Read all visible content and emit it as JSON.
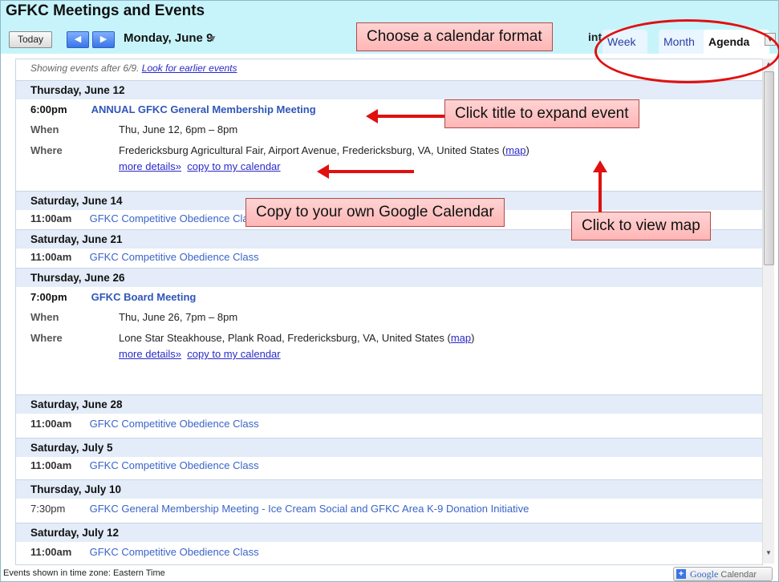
{
  "header": {
    "title": "GFKC Meetings and Events",
    "today_label": "Today",
    "prev_icon": "◀",
    "next_icon": "▶",
    "date": "Monday, June 9",
    "print_partial": "int",
    "tabs": [
      "Week",
      "Month",
      "Agenda"
    ]
  },
  "notice": {
    "text": "Showing events after 6/9.",
    "link": "Look for earlier events"
  },
  "days": [
    {
      "label": "Thursday, June 12"
    },
    {
      "label": "Saturday, June 14"
    },
    {
      "label": "Saturday, June 21"
    },
    {
      "label": "Thursday, June 26"
    },
    {
      "label": "Saturday, June 28"
    },
    {
      "label": "Saturday, July 5"
    },
    {
      "label": "Thursday, July 10"
    },
    {
      "label": "Saturday, July 12"
    }
  ],
  "events": [
    {
      "time": "6:00pm",
      "title": "ANNUAL GFKC General Membership Meeting"
    },
    {
      "time": "11:00am",
      "title": "GFKC Competitive Obedience Class"
    },
    {
      "time": "11:00am",
      "title": "GFKC Competitive Obedience Class"
    },
    {
      "time": "7:00pm",
      "title": "GFKC Board Meeting"
    },
    {
      "time": "11:00am",
      "title": "GFKC Competitive Obedience Class"
    },
    {
      "time": "11:00am",
      "title": "GFKC Competitive Obedience Class"
    },
    {
      "time": "7:30pm",
      "title": "GFKC General Membership Meeting - Ice Cream Social and GFKC Area K-9 Donation Initiative"
    },
    {
      "time": "11:00am",
      "title": "GFKC Competitive Obedience Class"
    }
  ],
  "details": {
    "when_label": "When",
    "where_label": "Where",
    "event1_when": "Thu, June 12, 6pm – 8pm",
    "event1_where": "Fredericksburg Agricultural Fair, Airport Avenue, Fredericksburg, VA, United States (",
    "event4_when": "Thu, June 26, 7pm – 8pm",
    "event4_where": "Lone Star Steakhouse, Plank Road, Fredericksburg, VA, United States (",
    "map_link": "map",
    "close_paren": ")",
    "more_details": "more details»",
    "copy_link": "copy to my calendar"
  },
  "footer": {
    "timezone": "Events shown in time zone: Eastern Time",
    "gcal_label": "Calendar",
    "gcal_logo": "Google"
  },
  "annotations": {
    "format": "Choose a calendar format",
    "expand": "Click title to expand event",
    "copy": "Copy to your own Google Calendar",
    "map": "Click to view map"
  },
  "colors": {
    "header_bg": "#c7f4fb",
    "day_row_bg": "#e3ecf8",
    "event_link": "#3a64c8",
    "annotation_red": "#e01010",
    "callout_fill": "#ffc4c4"
  }
}
